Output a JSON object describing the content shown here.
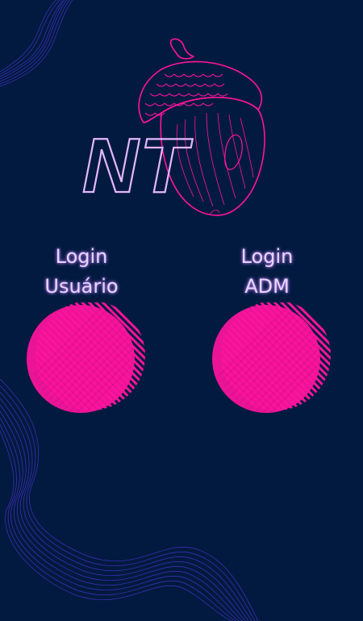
{
  "logo": {
    "text": "NT",
    "icon": "acorn-icon"
  },
  "login_user": {
    "line1": "Login",
    "line2": "Usuário"
  },
  "login_adm": {
    "line1": "Login",
    "line2": "ADM"
  },
  "colors": {
    "background": "#021a3f",
    "accent_pink": "#ff149d",
    "label_text": "#e9d4ff",
    "wave_purple": "#4b2bd6"
  }
}
